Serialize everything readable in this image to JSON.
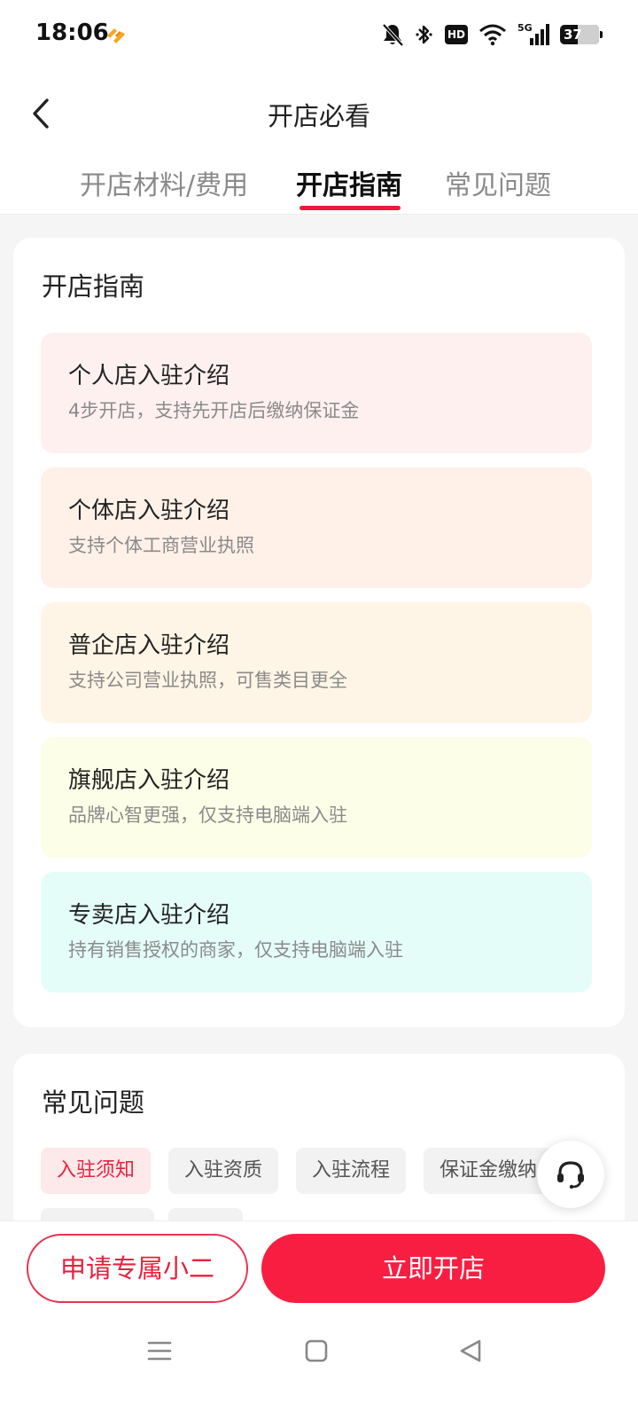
{
  "status_bar": {
    "time": "18:06",
    "hd": "HD",
    "network": "5G",
    "battery": "37",
    "icons": [
      "app-logo-icon",
      "bell-muted-icon",
      "bluetooth-icon",
      "hd-icon",
      "wifi-icon",
      "signal-icon",
      "battery-icon"
    ]
  },
  "header": {
    "title": "开店必看"
  },
  "tabs": [
    {
      "label": "开店材料/费用",
      "active": false
    },
    {
      "label": "开店指南",
      "active": true
    },
    {
      "label": "常见问题",
      "active": false
    }
  ],
  "guide": {
    "title": "开店指南",
    "items": [
      {
        "title": "个人店入驻介绍",
        "desc": "4步开店，支持先开店后缴纳保证金",
        "color": "#fff0f0"
      },
      {
        "title": "个体店入驻介绍",
        "desc": "支持个体工商营业执照",
        "color": "#fff1e8"
      },
      {
        "title": "普企店入驻介绍",
        "desc": "支持公司营业执照，可售类目更全",
        "color": "#fff5e6"
      },
      {
        "title": "旗舰店入驻介绍",
        "desc": "品牌心智更强，仅支持电脑端入驻",
        "color": "#fdfee8"
      },
      {
        "title": "专卖店入驻介绍",
        "desc": "持有销售授权的商家，仅支持电脑端入驻",
        "color": "#e5fdf9"
      }
    ]
  },
  "faq": {
    "title": "常见问题",
    "chips": [
      "入驻须知",
      "入驻资质",
      "入驻流程",
      "保证金缴纳"
    ]
  },
  "bottom": {
    "advisor_label": "申请专属小二",
    "open_label": "立即开店"
  },
  "colors": {
    "accent": "#f81e41",
    "accent_text": "#e6223f"
  }
}
